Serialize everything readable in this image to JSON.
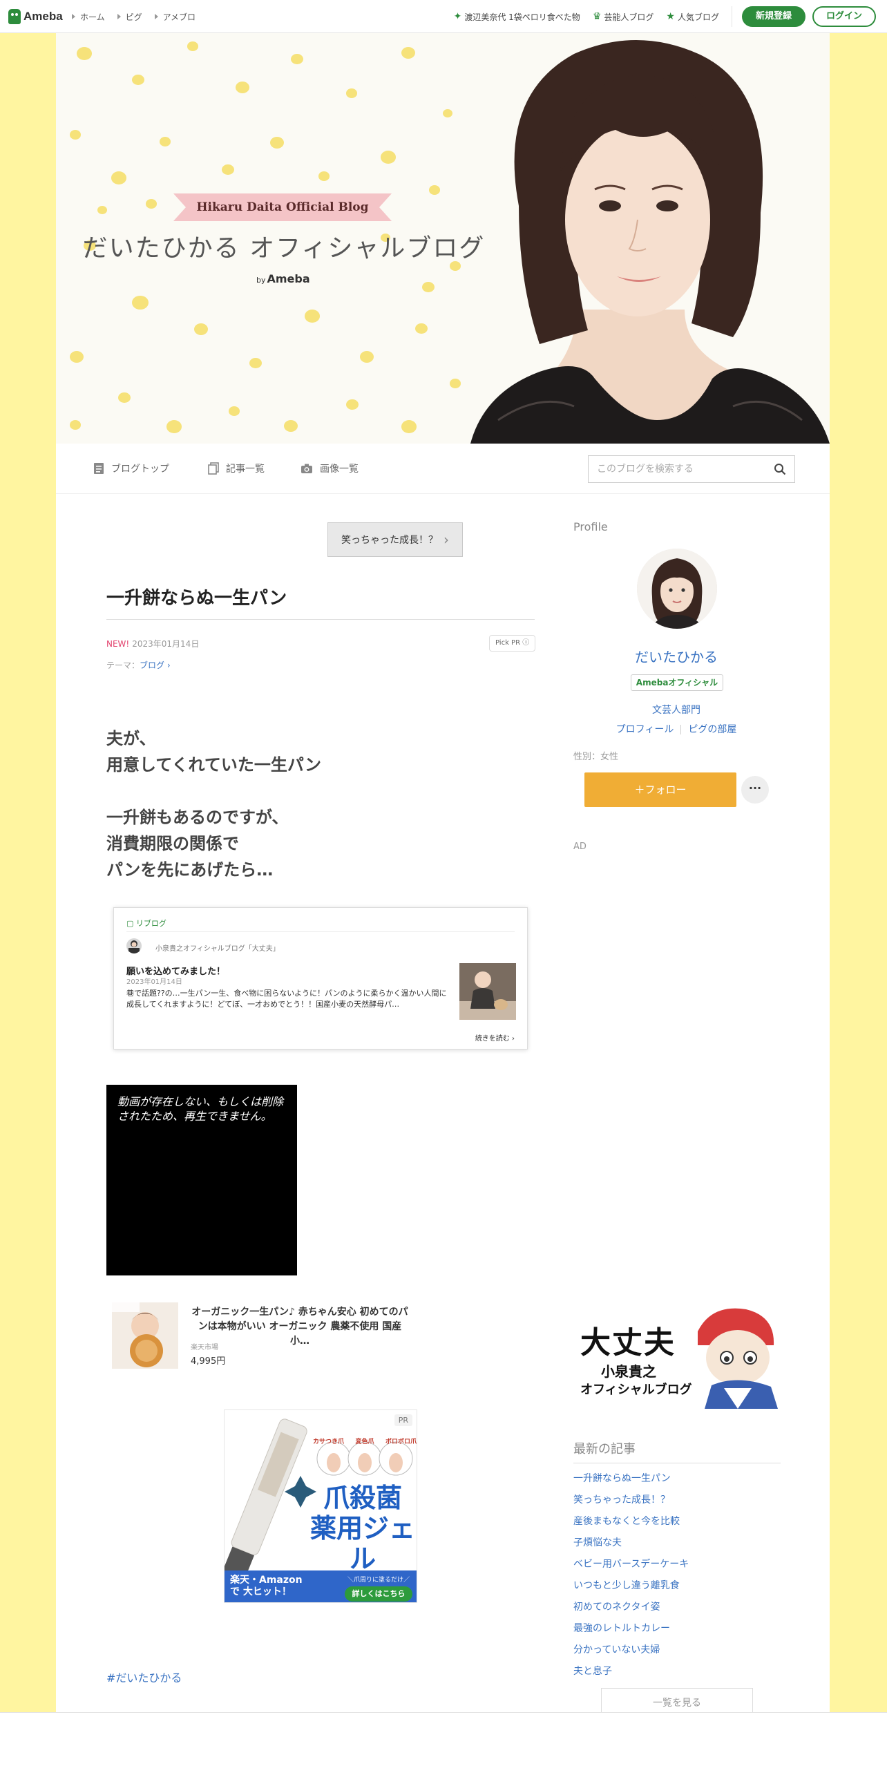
{
  "colors": {
    "ameba_green": "#2d8c3c",
    "link_blue": "#3a73c2",
    "follow_orange": "#f0ad35",
    "page_bg": "#fff5a0",
    "new_pink": "#e2426d"
  },
  "global": {
    "logo": "Ameba",
    "nav": [
      "ホーム",
      "ピグ",
      "アメブロ"
    ],
    "right_links": [
      {
        "icon": "sparkle-icon",
        "label": "渡辺美奈代 1袋ペロリ食べた物"
      },
      {
        "icon": "crown-icon",
        "label": "芸能人ブログ"
      },
      {
        "icon": "star-icon",
        "label": "人気ブログ"
      }
    ],
    "signup": "新規登録",
    "login": "ログイン"
  },
  "header": {
    "ribbon": "Hikaru Daita Official Blog",
    "title": "だいたひかる オフィシャルブログ",
    "by": "by",
    "ameba": "Ameba"
  },
  "blognav": {
    "top": "ブログトップ",
    "entries": "記事一覧",
    "images": "画像一覧",
    "search_placeholder": "このブログを検索する"
  },
  "entry": {
    "prev_title": "笑っちゃった成長！？",
    "title": "一升餅ならぬ一生パン",
    "new_badge": "NEW!",
    "date": "2023年01月14日",
    "pick_pr": "Pick PR",
    "theme_label": "テーマ：",
    "theme": "ブログ",
    "body": "夫が、\n用意してくれていた一生パン\n\n一升餅もあるのですが、\n消費期限の関係で\nパンを先にあげたら…",
    "reblog": {
      "header": "リブログ",
      "source": "小泉貴之オフィシャルブログ「大丈夫」",
      "title": "願いを込めてみました！",
      "date": "2023年01月14日",
      "excerpt": "巷で話題??の…一生パン一生、食べ物に困らないように！パンのように柔らかく温かい人間に成長してくれますように！どてぼ、一才おめでとう！！国産小麦の天然酵母パ…",
      "more": "続きを読む"
    },
    "video_message": "動画が存在しない、もしくは削除されたため、再生できません。",
    "product": {
      "name": "オーガニック一生パン♪ 赤ちゃん安心 初めてのパンは本物がいい オーガニック 農薬不使用 国産小…",
      "shop": "楽天市場",
      "price": "4,995円"
    },
    "ad": {
      "pr": "PR",
      "tags": [
        "カサつき爪",
        "変色爪",
        "ボロボロ爪"
      ],
      "headline1": "爪殺菌",
      "headline2": "薬用ジェル",
      "footer": "楽天・Amazonで 大ヒット！",
      "cta_small": "＼爪周りに塗るだけ／",
      "cta": "詳しくはこちら"
    },
    "hashtag": "#だいたひかる"
  },
  "sidebar": {
    "profile_heading": "Profile",
    "name": "だいたひかる",
    "badge": "Amebaオフィシャル",
    "category": "文芸人部門",
    "profile_link": "プロフィール",
    "pig_link": "ピグの部屋",
    "gender": "性別：女性",
    "follow": "＋フォロー",
    "more": "···",
    "ad_label": "AD",
    "banner": {
      "line1": "大丈夫",
      "line2": "小泉貴之",
      "line3": "オフィシャルブログ"
    },
    "recent_heading": "最新の記事",
    "recent": [
      "一升餅ならぬ一生パン",
      "笑っちゃった成長！？",
      "産後まもなくと今を比較",
      "子煩悩な夫",
      "ベビー用バースデーケーキ",
      "いつもと少し違う離乳食",
      "初めてのネクタイ姿",
      "最強のレトルトカレー",
      "分かっていない夫婦",
      "夫と息子"
    ],
    "see_all": "一覧を見る"
  }
}
